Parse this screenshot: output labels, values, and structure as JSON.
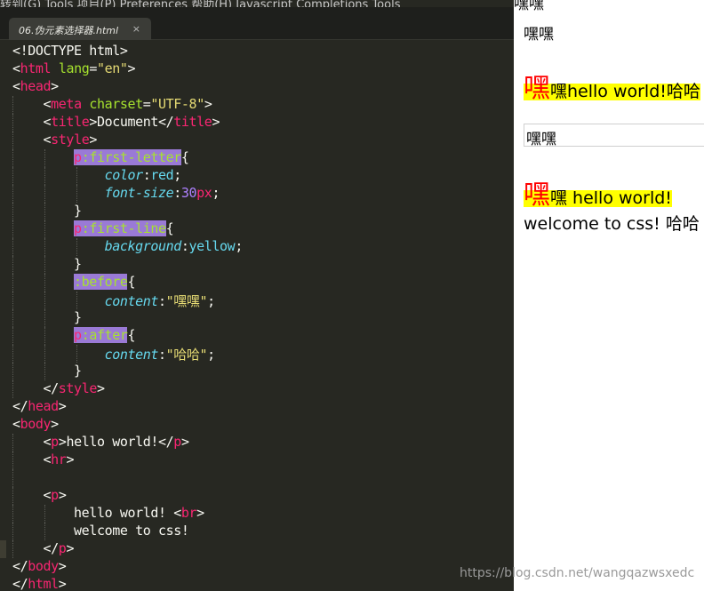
{
  "menu_bar": {
    "text": "转到(G)   Tools   项目(P)   Preferences   帮助(H)   Javascript Completions Tools"
  },
  "tab": {
    "filename": "06.伪元素选择器.html",
    "close_glyph": "×"
  },
  "code": {
    "l1": "<!DOCTYPE html>",
    "l2_lt": "<",
    "l2_tag": "html",
    "l2_attr": "lang",
    "l2_eq": "=",
    "l2_val": "\"en\"",
    "l2_gt": ">",
    "l3_lt": "<",
    "l3_tag": "head",
    "l3_gt": ">",
    "l4_lt": "<",
    "l4_tag": "meta",
    "l4_attr": "charset",
    "l4_eq": "=",
    "l4_val": "\"UTF-8\"",
    "l4_gt": ">",
    "l5_lt": "<",
    "l5_tag": "title",
    "l5_gt": ">",
    "l5_text": "Document",
    "l5_lt2": "</",
    "l5_tag2": "title",
    "l5_gt2": ">",
    "l6_lt": "<",
    "l6_tag": "style",
    "l6_gt": ">",
    "l7_sel": "p",
    "l7_pseudo": ":first-letter",
    "l7_brace": "{",
    "l8_prop": "color",
    "l8_colon": ":",
    "l8_val": "red",
    "l8_semi": ";",
    "l9_prop": "font-size",
    "l9_colon": ":",
    "l9_num": "30",
    "l9_unit": "px",
    "l9_semi": ";",
    "l10": "}",
    "l11_sel": "p",
    "l11_pseudo": ":first-line",
    "l11_brace": "{",
    "l12_prop": "background",
    "l12_colon": ":",
    "l12_val": "yellow",
    "l12_semi": ";",
    "l13": "}",
    "l14_pseudo": ":before",
    "l14_brace": "{",
    "l15_prop": "content",
    "l15_colon": ":",
    "l15_val": "\"嘿嘿\"",
    "l15_semi": ";",
    "l16": "}",
    "l17_sel": "p",
    "l17_pseudo": ":after",
    "l17_brace": "{",
    "l18_prop": "content",
    "l18_colon": ":",
    "l18_val": "\"哈哈\"",
    "l18_semi": ";",
    "l19": "}",
    "l20_lt": "</",
    "l20_tag": "style",
    "l20_gt": ">",
    "l21_lt": "</",
    "l21_tag": "head",
    "l21_gt": ">",
    "l22_lt": "<",
    "l22_tag": "body",
    "l22_gt": ">",
    "l23_lt": "<",
    "l23_tag": "p",
    "l23_gt": ">",
    "l23_text": "hello world!",
    "l23_lt2": "</",
    "l23_tag2": "p",
    "l23_gt2": ">",
    "l24_lt": "<",
    "l24_tag": "hr",
    "l24_gt": ">",
    "l26_lt": "<",
    "l26_tag": "p",
    "l26_gt": ">",
    "l27_text": "hello world! ",
    "l27_lt": "<",
    "l27_tag": "br",
    "l27_gt": ">",
    "l28_text": "welcome to css!",
    "l29_lt": "</",
    "l29_tag": "p",
    "l29_gt": ">",
    "l30_lt": "</",
    "l30_tag": "body",
    "l30_gt": ">",
    "l31_lt": "</",
    "l31_tag": "html",
    "l31_gt": ">"
  },
  "preview": {
    "top_text": "嘿嘿",
    "line1": "嘿嘿",
    "p2_first": "嘿",
    "p2_rest": "嘿hello world!哈哈",
    "hr_text": "嘿嘿",
    "p3_first": "嘿",
    "p3_rest": "嘿 hello world! ",
    "p3_line2": "welcome to css! 哈哈"
  },
  "watermark": "https://blog.csdn.net/wangqazwsxedc",
  "colors": {
    "editor_bg": "#272822",
    "tag": "#f92672",
    "attr": "#a6e22e",
    "string": "#e6db74",
    "property": "#66d9ef",
    "number": "#ae81ff",
    "selection": "#9a7ad6",
    "first_letter": "#ff0000",
    "first_line_bg": "#ffff00"
  }
}
